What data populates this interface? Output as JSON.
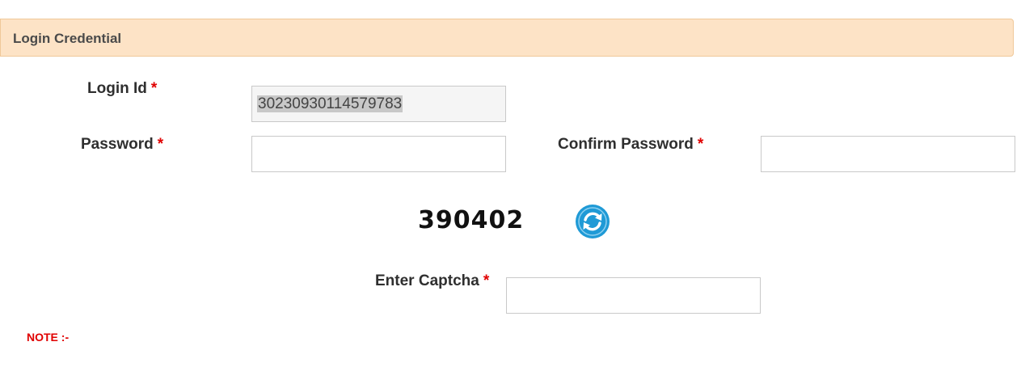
{
  "panel": {
    "title": "Login Credential"
  },
  "form": {
    "login_id": {
      "label": "Login Id",
      "required_marker": "*",
      "value": "30230930114579783"
    },
    "password": {
      "label": "Password",
      "required_marker": "*",
      "value": "",
      "placeholder": ""
    },
    "confirm_password": {
      "label": "Confirm Password",
      "required_marker": "*",
      "value": "",
      "placeholder": ""
    },
    "captcha": {
      "code": "390402",
      "refresh_icon": "refresh-icon",
      "label": "Enter Captcha",
      "required_marker": "*",
      "value": "",
      "placeholder": ""
    }
  },
  "note": {
    "text": "NOTE :-"
  },
  "colors": {
    "panel_background": "#fde3c6",
    "panel_border": "#f0c899",
    "required": "#e00000",
    "refresh_icon": "#1f9ad6"
  }
}
